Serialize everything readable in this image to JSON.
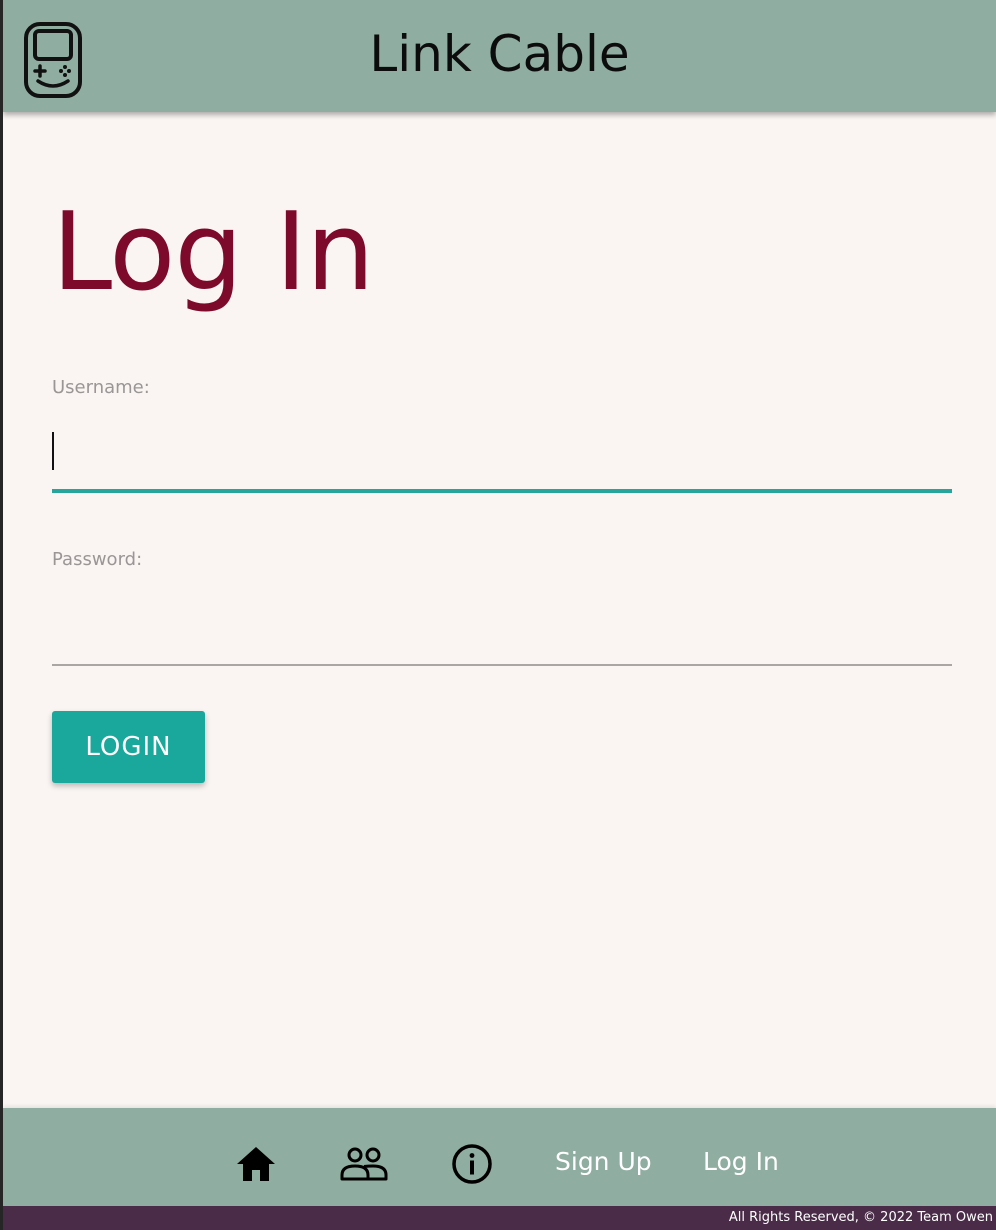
{
  "header": {
    "app_title": "Link Cable",
    "logo_icon": "gameboy-icon"
  },
  "main": {
    "heading": "Log In",
    "username": {
      "label": "Username:",
      "value": ""
    },
    "password": {
      "label": "Password:",
      "value": ""
    },
    "login_button_label": "LOGIN"
  },
  "bottom_nav": {
    "icons": [
      "home-icon",
      "people-icon",
      "info-icon"
    ],
    "signup_label": "Sign Up",
    "login_label": "Log In"
  },
  "footer": {
    "text": "All Rights Reserved, © 2022 Team Owen"
  },
  "colors": {
    "header_bg": "#8fada0",
    "heading": "#7d0a2b",
    "accent": "#1aa89c",
    "footer_bg": "#4a2c48",
    "page_bg": "#faf5f3"
  }
}
